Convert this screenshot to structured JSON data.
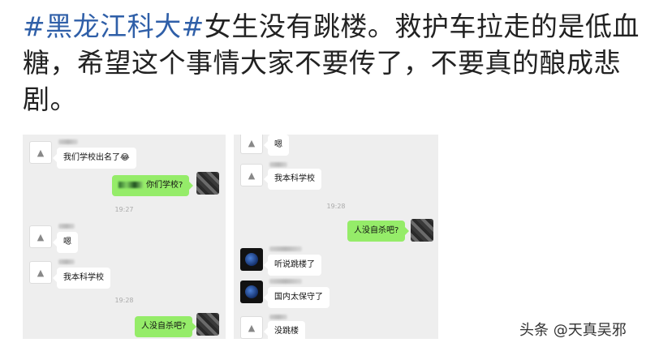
{
  "post": {
    "hashtag": "#黑龙江科大#",
    "text": "女生没有跳楼。救护车拉走的是低血糖，希望这个事情大家不要传了，不要真的酿成悲剧。"
  },
  "chat_left": {
    "m1": "我们学校出名了",
    "m1_emoji": "😂",
    "m2": "你们学校?",
    "t1": "19:27",
    "m3": "嗯",
    "m4": "我本科学校",
    "t2": "19:28",
    "m5": "人没自杀吧?"
  },
  "chat_right": {
    "m1": "嗯",
    "m2": "我本科学校",
    "t1": "19:28",
    "m3": "人没自杀吧?",
    "m4": "听说跳楼了",
    "m5": "国内太保守了",
    "m6": "没跳楼"
  },
  "watermark": "头条 @天真吴邪"
}
